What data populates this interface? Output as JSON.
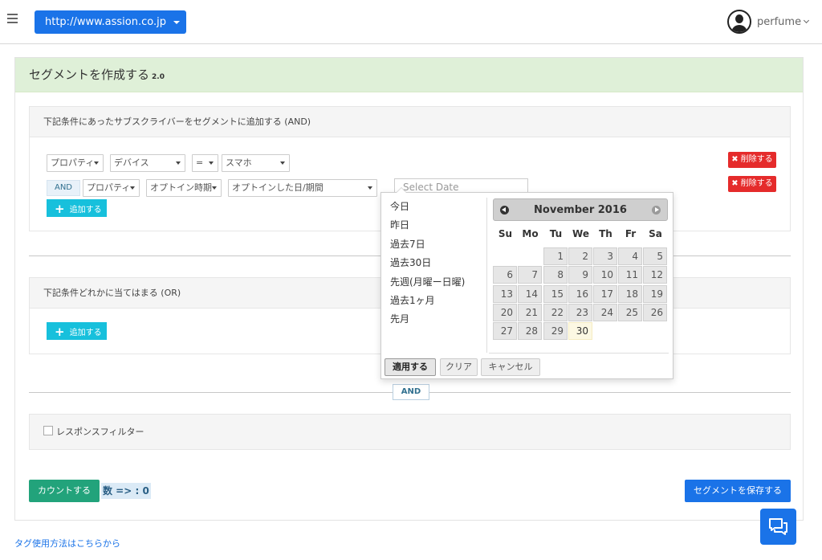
{
  "header": {
    "url_select": "http://www.assion.co.jp",
    "user_name": "perfume"
  },
  "card": {
    "title": "セグメントを作成する",
    "version": "2.0"
  },
  "and_panel": {
    "title": "下記条件にあったサブスクライバーをセグメントに追加する (AND)",
    "row1": {
      "property": "プロパティ",
      "device": "デバイス",
      "operator": "=",
      "value": "スマホ",
      "delete": "削除する"
    },
    "row2": {
      "and": "AND",
      "property": "プロパティ",
      "optin": "オプトイン時期",
      "optin_date": "オプトインした日/期間",
      "date_placeholder": "Select Date",
      "delete": "削除する"
    },
    "add": "追加する"
  },
  "or_panel": {
    "title": "下記条件どれかに当てはまる (OR)",
    "add": "追加する"
  },
  "and_connector": "AND",
  "response_filter": "レスポンスフィルター",
  "actions": {
    "count_button": "カウントする",
    "count_text": "数 => : 0",
    "save_button": "セグメントを保存する"
  },
  "footer_link": "タグ使用方法はこちらから",
  "datepicker": {
    "ranges": [
      "今日",
      "昨日",
      "過去7日",
      "過去30日",
      "先週(月曜ー日曜)",
      "過去1ヶ月",
      "先月"
    ],
    "month_title": "November 2016",
    "weekdays": [
      "Su",
      "Mo",
      "Tu",
      "We",
      "Th",
      "Fr",
      "Sa"
    ],
    "weeks": [
      [
        "",
        "",
        "1",
        "2",
        "3",
        "4",
        "5"
      ],
      [
        "6",
        "7",
        "8",
        "9",
        "10",
        "11",
        "12"
      ],
      [
        "13",
        "14",
        "15",
        "16",
        "17",
        "18",
        "19"
      ],
      [
        "20",
        "21",
        "22",
        "23",
        "24",
        "25",
        "26"
      ],
      [
        "27",
        "28",
        "29",
        "30",
        "",
        "",
        ""
      ]
    ],
    "today": "30",
    "apply": "適用する",
    "clear": "クリア",
    "cancel": "キャンセル"
  },
  "colors": {
    "primary": "#1a73e8",
    "header_green": "#dff0d8",
    "danger": "#e52b2b",
    "info": "#17c0dc",
    "success": "#22a37b"
  }
}
